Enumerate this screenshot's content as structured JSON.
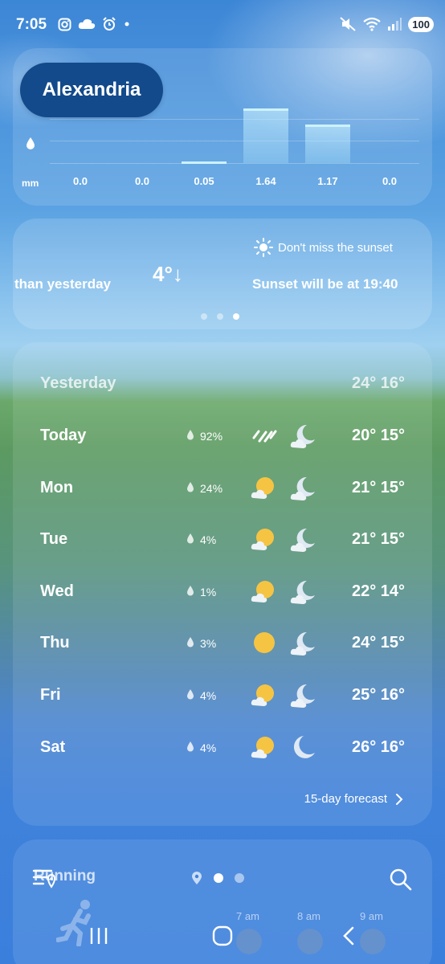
{
  "status_bar": {
    "time": "7:05",
    "battery": "100",
    "left_icons": [
      "instagram-icon",
      "cloud-icon",
      "alarm-icon",
      "dot-icon"
    ],
    "right_icons": [
      "mute-icon",
      "wifi-icon",
      "signal-icon"
    ]
  },
  "location": {
    "city": "Alexandria"
  },
  "precipitation": {
    "unit": "mm",
    "values": [
      "0.0",
      "0.0",
      "0.05",
      "1.64",
      "1.17",
      "0.0"
    ],
    "amounts": [
      0.0,
      0.0,
      0.05,
      1.64,
      1.17,
      0.0
    ],
    "max": 1.7
  },
  "insights": {
    "compare_text": "than yesterday",
    "temp_delta": "4°↓",
    "tip": "Don't miss the sunset",
    "sunset_text": "Sunset will be at 19:40",
    "page_count": 3,
    "active_page": 2
  },
  "forecast": {
    "yesterday": {
      "day": "Yesterday",
      "temps": "24° 16°"
    },
    "days": [
      {
        "day": "Today",
        "precip": "92%",
        "day_icon": "rain-icon",
        "night_icon": "cloudy-night-icon",
        "temps": "20° 15°"
      },
      {
        "day": "Mon",
        "precip": "24%",
        "day_icon": "partly-cloudy-icon",
        "night_icon": "cloudy-night-icon",
        "temps": "21° 15°"
      },
      {
        "day": "Tue",
        "precip": "4%",
        "day_icon": "partly-cloudy-icon",
        "night_icon": "cloudy-night-icon",
        "temps": "21° 15°"
      },
      {
        "day": "Wed",
        "precip": "1%",
        "day_icon": "partly-cloudy-icon",
        "night_icon": "cloudy-night-icon",
        "temps": "22° 14°"
      },
      {
        "day": "Thu",
        "precip": "3%",
        "day_icon": "sun-icon",
        "night_icon": "cloudy-night-icon",
        "temps": "24° 15°"
      },
      {
        "day": "Fri",
        "precip": "4%",
        "day_icon": "partly-cloudy-icon",
        "night_icon": "cloudy-night-icon",
        "temps": "25° 16°"
      },
      {
        "day": "Sat",
        "precip": "4%",
        "day_icon": "partly-cloudy-icon",
        "night_icon": "moon-icon",
        "temps": "26° 16°"
      }
    ],
    "link_label": "15-day forecast"
  },
  "activity": {
    "title": "Running",
    "hours": [
      "7 am",
      "8 am",
      "9 am"
    ]
  },
  "location_pager": {
    "count": 2,
    "active": 0
  },
  "colors": {
    "city_pill": "#124a8c",
    "sun": "#f6c443",
    "bar": "#cdf2ff"
  }
}
